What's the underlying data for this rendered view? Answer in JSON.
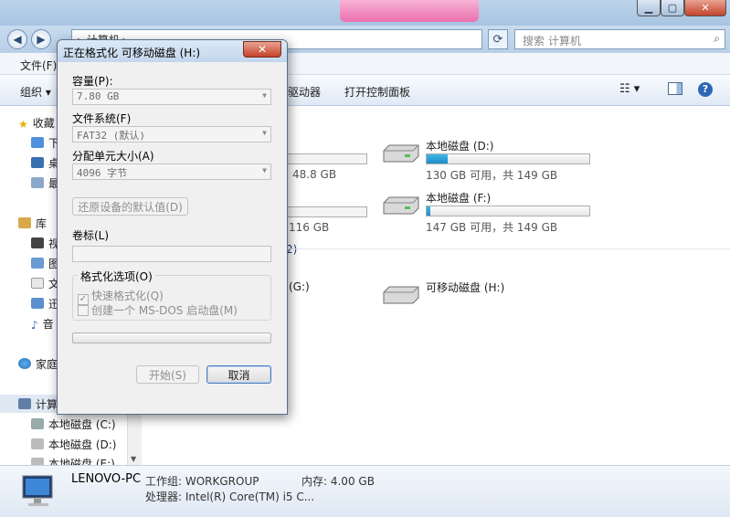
{
  "explorer": {
    "address": "▸ 计算机 ▸",
    "search_placeholder": "搜索 计算机",
    "menu": {
      "file": "文件(F)"
    },
    "commands": {
      "organize": "组织",
      "map_drive": "驱动器",
      "open_control_panel": "打开控制面板"
    },
    "nav": {
      "favorites": "收藏",
      "fav_items": [
        "下",
        "桌",
        "最"
      ],
      "libraries": "库",
      "lib_items": [
        "视",
        "图",
        "文",
        "迅",
        "音"
      ],
      "homegroup": "家庭",
      "computer": "计算",
      "drives": [
        "本地磁盘 (C:)",
        "本地磁盘 (D:)",
        "本地磁盘 (E:)"
      ]
    },
    "content": {
      "left_partial": [
        {
          "free": "48.8 GB"
        },
        {
          "free": "116 GB"
        }
      ],
      "drives": [
        {
          "name": "本地磁盘 (D:)",
          "free": "130 GB 可用，共 149 GB",
          "fill_percent": 13
        },
        {
          "name": "本地磁盘 (F:)",
          "free": "147 GB 可用，共 149 GB",
          "fill_percent": 2
        }
      ],
      "group_label": "2)",
      "g_label": "(G:)",
      "removable": {
        "name": "可移动磁盘 (H:)"
      }
    },
    "details": {
      "pc_name": "LENOVO-PC",
      "workgroup": "工作组: WORKGROUP",
      "memory": "内存: 4.00 GB",
      "processor": "处理器: Intel(R) Core(TM) i5 C..."
    }
  },
  "dialog": {
    "title": "正在格式化 可移动磁盘 (H:)",
    "close_label": "✕",
    "capacity_label": "容量(P):",
    "capacity_value": "7.80 GB",
    "filesystem_label": "文件系统(F)",
    "filesystem_value": "FAT32 (默认)",
    "allocation_label": "分配单元大小(A)",
    "allocation_value": "4096 字节",
    "restore_defaults": "还原设备的默认值(D)",
    "volume_label": "卷标(L)",
    "volume_value": "",
    "options_title": "格式化选项(O)",
    "quick_format": "快速格式化(Q)",
    "quick_format_checked": true,
    "msdos_boot": "创建一个 MS-DOS 启动盘(M)",
    "msdos_checked": false,
    "progress_percent": 0,
    "start_button": "开始(S)",
    "close_button": "取消"
  },
  "colors": {
    "accent": "#1e8bc9",
    "titlebar": "#bcd3ea",
    "close_red": "#c5432a"
  }
}
